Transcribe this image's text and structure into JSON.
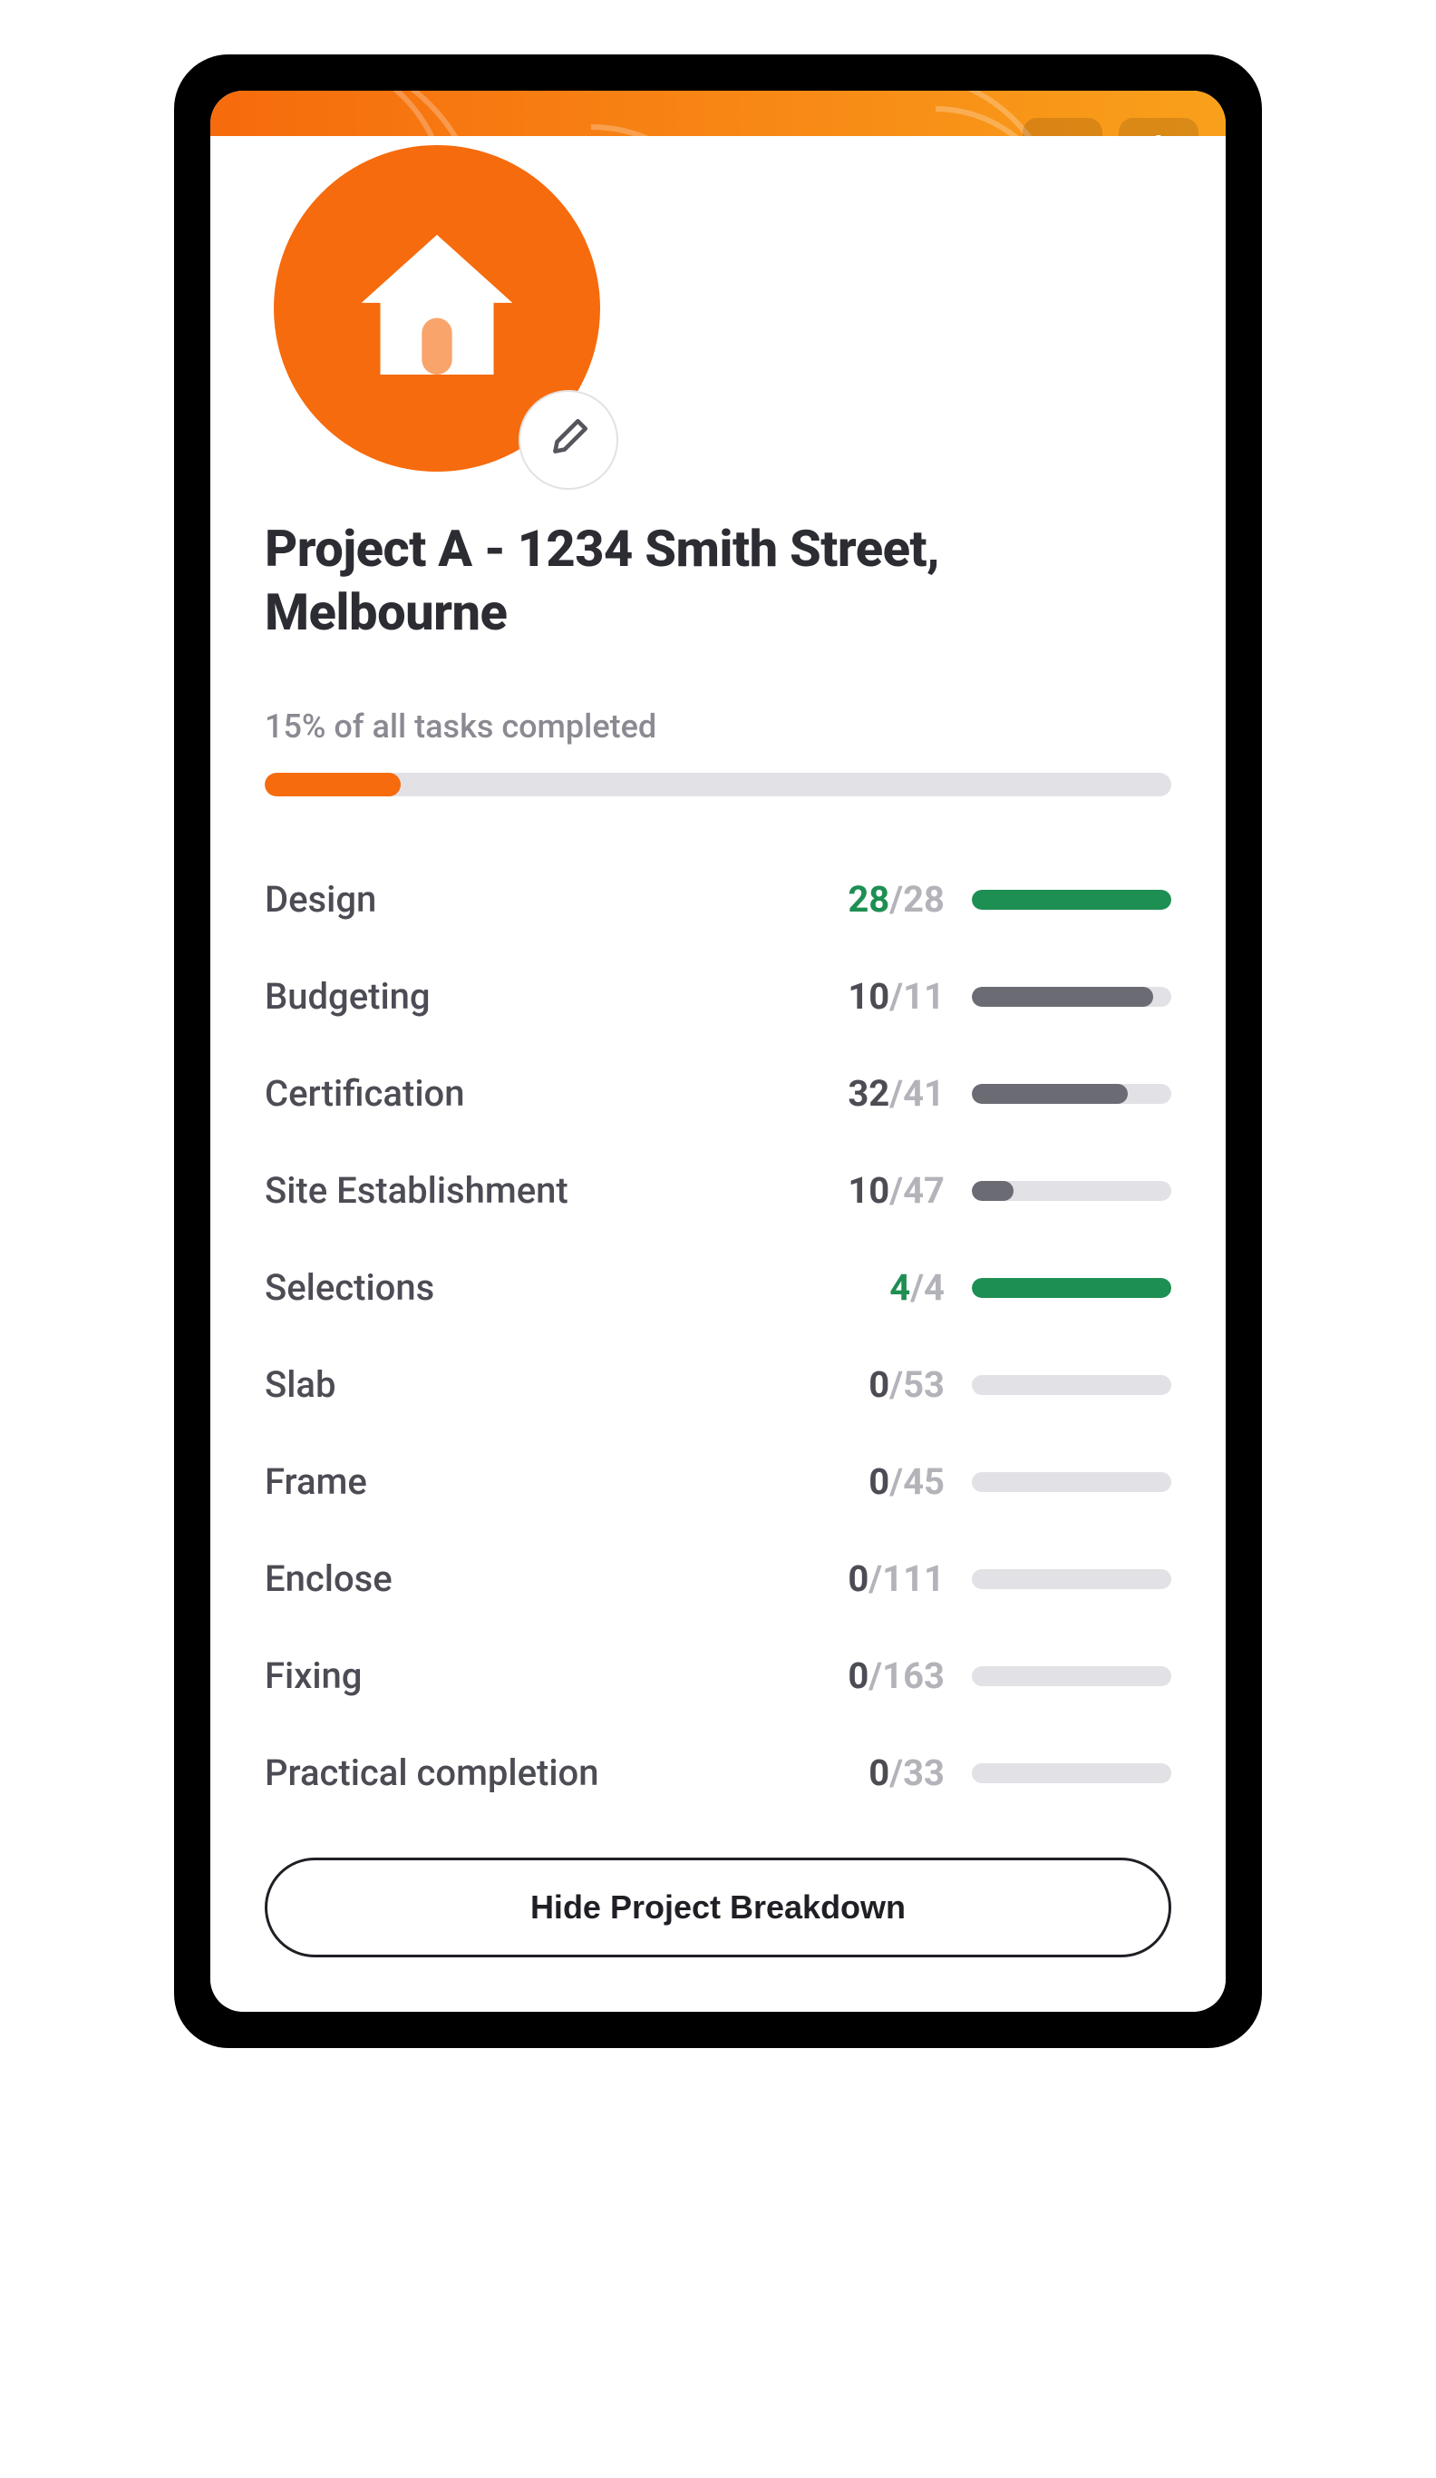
{
  "colors": {
    "brand_orange": "#f66b0d",
    "brand_orange_light": "#f9a01b",
    "progress_green": "#1e8f53",
    "progress_grey": "#6b6b74",
    "bar_track": "#e2e2e6"
  },
  "header": {
    "edit_icon": "pencil-icon",
    "settings_icon": "gear-icon"
  },
  "avatar": {
    "icon": "home-icon",
    "edit_icon": "pencil-icon"
  },
  "project": {
    "title": "Project A - 1234 Smith Street, Melbourne"
  },
  "overall": {
    "label": "15% of all tasks completed",
    "percent": 15
  },
  "tasks": [
    {
      "label": "Design",
      "done": 28,
      "total": 28
    },
    {
      "label": "Budgeting",
      "done": 10,
      "total": 11
    },
    {
      "label": "Certification",
      "done": 32,
      "total": 41
    },
    {
      "label": "Site Establishment",
      "done": 10,
      "total": 47
    },
    {
      "label": "Selections",
      "done": 4,
      "total": 4
    },
    {
      "label": "Slab",
      "done": 0,
      "total": 53
    },
    {
      "label": "Frame",
      "done": 0,
      "total": 45
    },
    {
      "label": "Enclose",
      "done": 0,
      "total": 111
    },
    {
      "label": "Fixing",
      "done": 0,
      "total": 163
    },
    {
      "label": "Practical completion",
      "done": 0,
      "total": 33
    }
  ],
  "hide_button": {
    "label": "Hide Project Breakdown"
  }
}
